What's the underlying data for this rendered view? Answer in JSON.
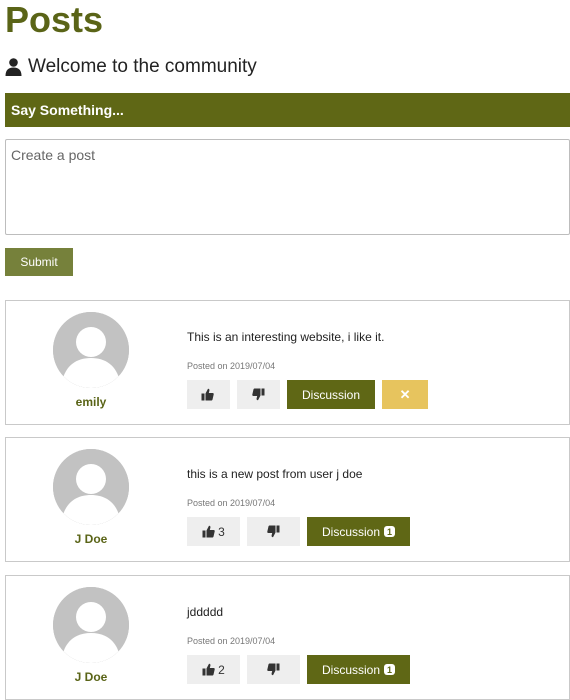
{
  "page": {
    "title": "Posts",
    "welcome": "Welcome to the community"
  },
  "composer": {
    "header": "Say Something...",
    "placeholder": "Create a post",
    "submit_label": "Submit"
  },
  "posts": [
    {
      "username": "emily",
      "text": "This is an interesting website, i like it.",
      "date": "Posted on 2019/07/04",
      "likes": "",
      "discussion_label": "Discussion",
      "discussion_count": "",
      "delete_icon": "✕"
    },
    {
      "username": "J Doe",
      "text": "this is a new post from user j doe",
      "date": "Posted on 2019/07/04",
      "likes": "3",
      "discussion_label": "Discussion",
      "discussion_count": "1"
    },
    {
      "username": "J Doe",
      "text": "jddddd",
      "date": "Posted on 2019/07/04",
      "likes": "2",
      "discussion_label": "Discussion",
      "discussion_count": "1"
    }
  ],
  "icons": {
    "user": "user-icon",
    "like": "thumbs-up-icon",
    "dislike": "thumbs-down-icon",
    "delete": "close-icon"
  },
  "colors": {
    "brand": "#5f6715",
    "submit": "#76813b",
    "delete": "#e7c45e",
    "neutral_button": "#eeeeee"
  }
}
